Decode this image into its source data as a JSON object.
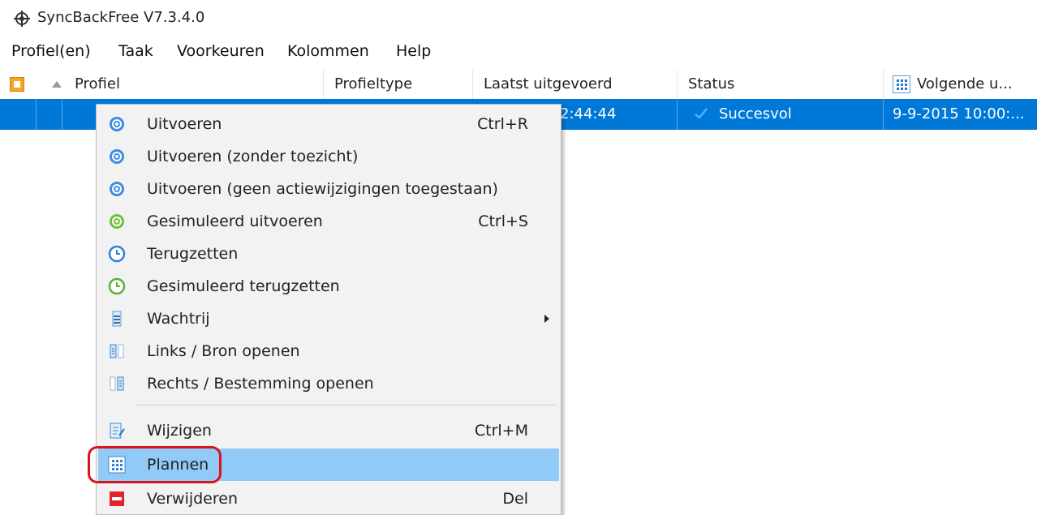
{
  "window": {
    "title": "SyncBackFree V7.3.4.0",
    "icon": "syncback-app-icon"
  },
  "menubar": {
    "items": [
      "Profiel(en)",
      "Taak",
      "Voorkeuren",
      "Kolommen",
      "Help"
    ]
  },
  "table": {
    "columns": [
      "Profiel",
      "Profieltype",
      "Laatst uitgevoerd",
      "Status",
      "Volgende u..."
    ],
    "rows": [
      {
        "profile": "",
        "type": "",
        "last_run": "2:44:44",
        "status": "Succesvol",
        "next_run": "9-9-2015 10:00:..."
      }
    ]
  },
  "context_menu": {
    "items": [
      {
        "label": "Uitvoeren",
        "shortcut": "Ctrl+R",
        "icon": "run-gear-icon"
      },
      {
        "label": "Uitvoeren (zonder toezicht)",
        "shortcut": "",
        "icon": "run-gear-icon"
      },
      {
        "label": "Uitvoeren (geen actiewijzigingen toegestaan)",
        "shortcut": "",
        "icon": "run-gear-icon"
      },
      {
        "label": "Gesimuleerd uitvoeren",
        "shortcut": "Ctrl+S",
        "icon": "simulate-gear-icon"
      },
      {
        "label": "Terugzetten",
        "shortcut": "",
        "icon": "restore-clock-icon"
      },
      {
        "label": "Gesimuleerd terugzetten",
        "shortcut": "",
        "icon": "simulate-restore-clock-icon"
      },
      {
        "label": "Wachtrij",
        "shortcut": "",
        "icon": "queue-icon",
        "submenu": true
      },
      {
        "label": "Links / Bron openen",
        "shortcut": "",
        "icon": "open-left-source-icon"
      },
      {
        "label": "Rechts / Bestemming openen",
        "shortcut": "",
        "icon": "open-right-destination-icon"
      },
      {
        "label": "Wijzigen",
        "shortcut": "Ctrl+M",
        "icon": "edit-icon"
      },
      {
        "label": "Plannen",
        "shortcut": "",
        "icon": "schedule-grid-icon",
        "highlighted": true
      },
      {
        "label": "Verwijderen",
        "shortcut": "Del",
        "icon": "delete-icon"
      }
    ]
  },
  "colors": {
    "selection": "#0078d7",
    "menu_highlight": "#91c9f7",
    "annotation": "#d9141d"
  }
}
